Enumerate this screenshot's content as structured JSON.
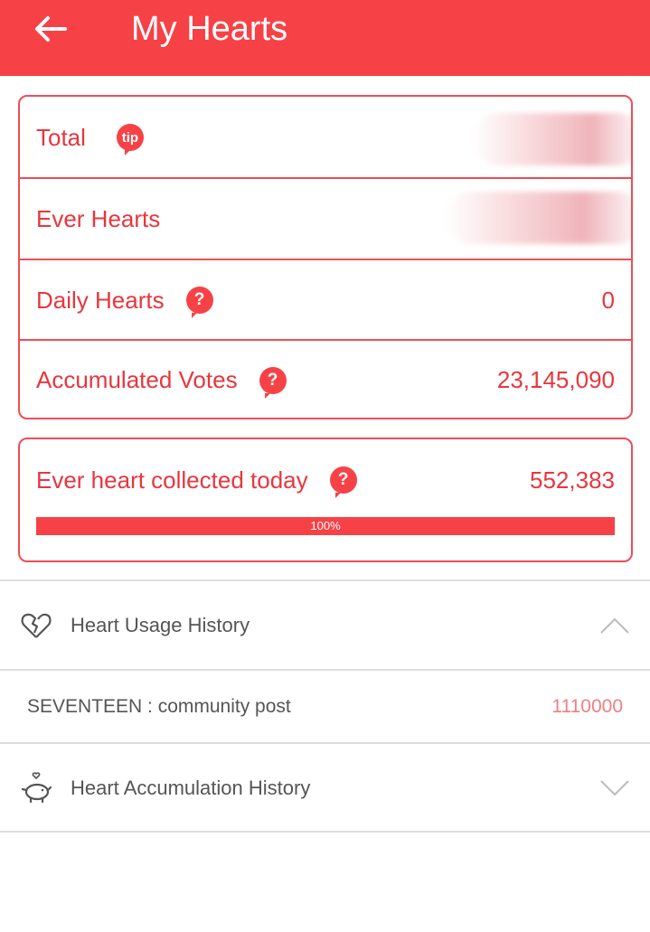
{
  "header": {
    "title": "My Hearts",
    "background": "#f64246"
  },
  "stats": {
    "total_label": "Total",
    "tip_badge": "tip",
    "ever_hearts_label": "Ever Hearts",
    "daily_hearts_label": "Daily Hearts",
    "daily_hearts_value": "0",
    "accumulated_votes_label": "Accumulated Votes",
    "accumulated_votes_value": "23,145,090",
    "help_glyph": "?"
  },
  "today": {
    "label": "Ever heart collected today",
    "value": "552,383",
    "progress_text": "100%",
    "progress_fraction": 1.0
  },
  "usage_history": {
    "title": "Heart Usage History",
    "expanded": true,
    "items": [
      {
        "name": "SEVENTEEN : community post",
        "amount": "1110000"
      }
    ]
  },
  "accumulation_history": {
    "title": "Heart Accumulation History",
    "expanded": false
  },
  "colors": {
    "accent": "#f64246",
    "text_red": "#e8363e",
    "amount_pink": "#ef7f84",
    "divider": "#dedede"
  }
}
